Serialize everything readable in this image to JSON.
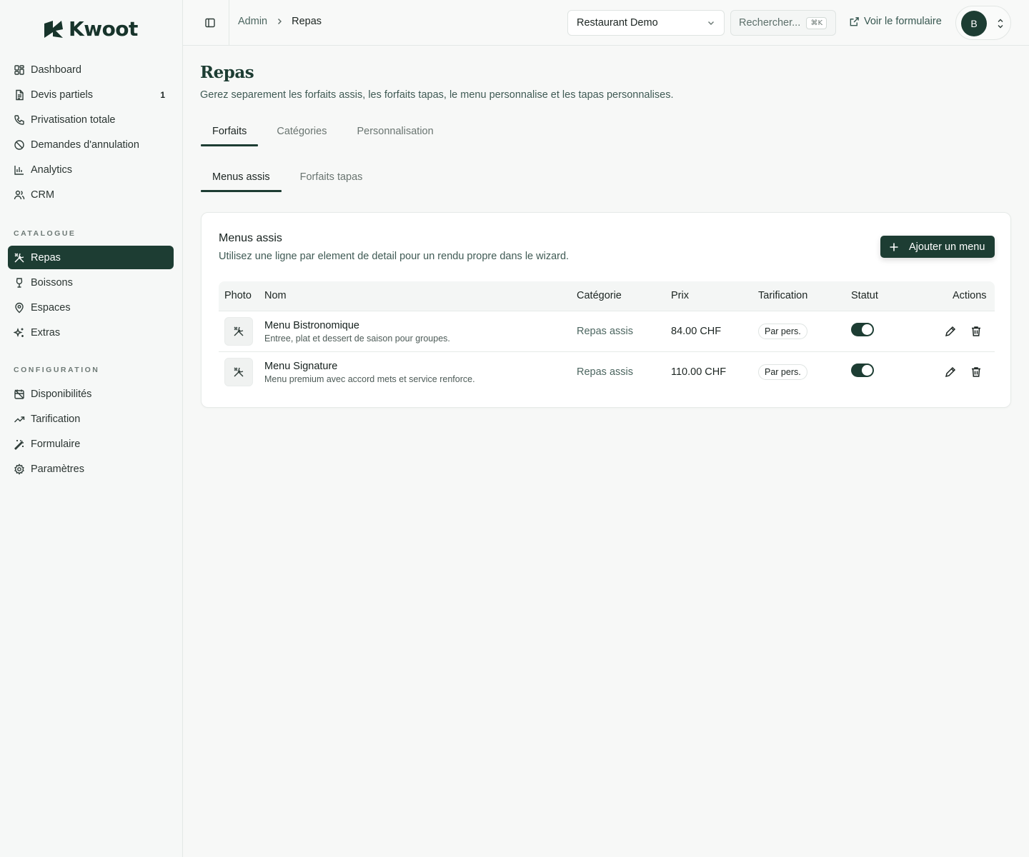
{
  "brand": {
    "name": "Kwoot"
  },
  "sidebar": {
    "main": [
      {
        "label": "Dashboard",
        "icon": "layout-dashboard-icon"
      },
      {
        "label": "Devis partiels",
        "icon": "file-text-icon",
        "badge": "1"
      },
      {
        "label": "Privatisation totale",
        "icon": "phone-icon"
      },
      {
        "label": "Demandes d'annulation",
        "icon": "ban-icon"
      },
      {
        "label": "Analytics",
        "icon": "bar-chart-icon"
      },
      {
        "label": "CRM",
        "icon": "users-icon"
      }
    ],
    "catalogue_label": "CATALOGUE",
    "catalogue": [
      {
        "label": "Repas",
        "icon": "utensils-crossed-icon",
        "active": true
      },
      {
        "label": "Boissons",
        "icon": "wine-icon"
      },
      {
        "label": "Espaces",
        "icon": "map-pin-icon"
      },
      {
        "label": "Extras",
        "icon": "sparkles-icon"
      }
    ],
    "config_label": "CONFIGURATION",
    "config": [
      {
        "label": "Disponibilités",
        "icon": "calendar-off-icon"
      },
      {
        "label": "Tarification",
        "icon": "trending-up-icon"
      },
      {
        "label": "Formulaire",
        "icon": "wand-icon"
      },
      {
        "label": "Paramètres",
        "icon": "settings-icon"
      }
    ]
  },
  "topbar": {
    "breadcrumb": {
      "parent": "Admin",
      "current": "Repas"
    },
    "restaurant_select": "Restaurant Demo",
    "search_placeholder": "Rechercher...",
    "search_shortcut": "⌘K",
    "view_form_label": "Voir le formulaire",
    "avatar_initial": "B"
  },
  "page": {
    "title": "Repas",
    "subtitle": "Gerez separement les forfaits assis, les forfaits tapas, le menu personnalise et les tapas personnalises.",
    "tabs": [
      {
        "label": "Forfaits",
        "active": true
      },
      {
        "label": "Catégories",
        "active": false
      },
      {
        "label": "Personnalisation",
        "active": false
      }
    ],
    "subtabs": [
      {
        "label": "Menus assis",
        "active": true
      },
      {
        "label": "Forfaits tapas",
        "active": false
      }
    ]
  },
  "card": {
    "title": "Menus assis",
    "subtitle": "Utilisez une ligne par element de detail pour un rendu propre dans le wizard.",
    "add_button": "Ajouter un menu",
    "columns": [
      "Photo",
      "Nom",
      "Catégorie",
      "Prix",
      "Tarification",
      "Statut",
      "Actions"
    ],
    "rows": [
      {
        "name": "Menu Bistronomique",
        "description": "Entree, plat et dessert de saison pour groupes.",
        "category": "Repas assis",
        "price": "84.00 CHF",
        "pricing": "Par pers.",
        "status_on": true
      },
      {
        "name": "Menu Signature",
        "description": "Menu premium avec accord mets et service renforce.",
        "category": "Repas assis",
        "price": "110.00 CHF",
        "pricing": "Par pers.",
        "status_on": true
      }
    ]
  },
  "colors": {
    "accent": "#1d3d33",
    "muted_link": "#4c6660"
  }
}
